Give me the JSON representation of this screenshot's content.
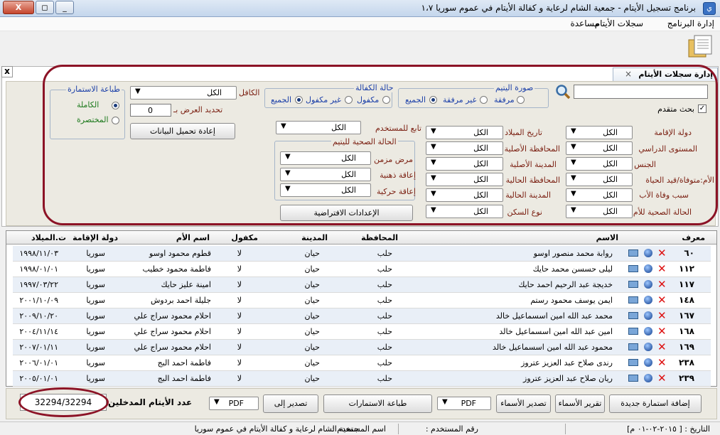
{
  "window": {
    "title": "برنامج تسجيل الأيتام - جمعية الشام لرعاية و كفالة الأيتام في عموم سوريا ١،٧",
    "minimize": "_",
    "restore": "◻",
    "close": "X"
  },
  "menu": [
    "إدارة البرنامج",
    "سجلات الأيتام",
    "مساعدة"
  ],
  "tab": {
    "label": "إدارة سجلات الأيتام",
    "close": "×"
  },
  "filters": {
    "advanced_search": "بحث متقدم",
    "photo_group": {
      "title": "صورة اليتيم",
      "options": [
        "مرفقة",
        "غير مرفقة",
        "الجميع"
      ],
      "selected": "الجميع"
    },
    "sponsorship_group": {
      "title": "حالة الكفالة",
      "options": [
        "مكفول",
        "غير مكفول",
        "الجميع"
      ],
      "selected": "الجميع"
    },
    "sponsor_label": "الكافل",
    "sponsor_value": "الكل",
    "limit_label": "تحديد العرض بـ",
    "limit_value": "0",
    "reload_button": "إعادة تحميل البيانات",
    "print_group": {
      "title": "طباعة الاستمارة",
      "options": [
        "الكاملة",
        "المختصرة"
      ],
      "selected": "الكاملة"
    },
    "user_label": "تابع للمستخدم",
    "user_value": "الكل",
    "health_group_title": "الحالة الصحية لليتيم",
    "health_fields": [
      {
        "label": "مرض مزمن",
        "value": "الكل"
      },
      {
        "label": "إعاقة ذهنية",
        "value": "الكل"
      },
      {
        "label": "إعاقة حركية",
        "value": "الكل"
      }
    ],
    "defaults_button": "الإعدادات الافتراضية",
    "col1": [
      {
        "label": "دولة الإقامة",
        "value": "الكل"
      },
      {
        "label": "المستوى الدراسي",
        "value": "الكل"
      },
      {
        "label": "الجنس",
        "value": "الكل"
      },
      {
        "label": "الأم:متوفاة/قيد الحياة",
        "value": "الكل"
      },
      {
        "label": "سبب وفاة الأب",
        "value": "الكل"
      },
      {
        "label": "الحالة الصحية للأم",
        "value": "الكل"
      }
    ],
    "col2": [
      {
        "label": "تاريخ الميلاد",
        "value": "الكل"
      },
      {
        "label": "المحافظة الأصلية",
        "value": "الكل"
      },
      {
        "label": "المدينة الأصلية",
        "value": "الكل"
      },
      {
        "label": "المحافظة الحالية",
        "value": "الكل"
      },
      {
        "label": "المدينة الحالية",
        "value": "الكل"
      },
      {
        "label": "نوع السكن",
        "value": "الكل"
      }
    ]
  },
  "table": {
    "headers": {
      "code": "معرف",
      "name": "الاسم",
      "province": "المحافظة",
      "city": "المدينة",
      "sponsored": "مكفول",
      "mother": "اسم الأم",
      "country": "دولة الإقامة",
      "dob": "ت.الميلاد"
    },
    "rows": [
      {
        "code": "٦٠",
        "name": "روابة محمد منصور اوسو",
        "province": "حلب",
        "city": "حيان",
        "sponsored": "لا",
        "mother": "قطوم محمود اوسو",
        "country": "سوريا",
        "dob": "١٩٩٨/١١/٠٣"
      },
      {
        "code": "١١٢",
        "name": "ليلى حسسن محمد حايك",
        "province": "حلب",
        "city": "حيان",
        "sponsored": "لا",
        "mother": "فاطمة محمود خطيب",
        "country": "سوريا",
        "dob": "١٩٩٨/٠١/٠١"
      },
      {
        "code": "١١٧",
        "name": "خديجة عبد الرحيم احمد حايك",
        "province": "حلب",
        "city": "حيان",
        "sponsored": "لا",
        "mother": "امينة عليز حايك",
        "country": "سوريا",
        "dob": "١٩٩٧/٠٣/٢٢"
      },
      {
        "code": "١٤٨",
        "name": "ايمن يوسف محمود رستم",
        "province": "حلب",
        "city": "حيان",
        "sponsored": "لا",
        "mother": "جليلة احمد بردوش",
        "country": "سوريا",
        "dob": "٢٠٠١/١٠/٠٩"
      },
      {
        "code": "١٦٧",
        "name": "محمد عبد الله امين اسسماعيل خالد",
        "province": "حلب",
        "city": "حيان",
        "sponsored": "لا",
        "mother": "احلام محمود سراج علي",
        "country": "سوريا",
        "dob": "٢٠٠٩/١٠/٢٠"
      },
      {
        "code": "١٦٨",
        "name": "امين عبد الله امين اسسماعيل خالد",
        "province": "حلب",
        "city": "حيان",
        "sponsored": "لا",
        "mother": "احلام محمود سراج علي",
        "country": "سوريا",
        "dob": "٢٠٠٤/١١/١٤"
      },
      {
        "code": "١٦٩",
        "name": "محمود عبد الله امين اسسماعيل خالد",
        "province": "حلب",
        "city": "حيان",
        "sponsored": "لا",
        "mother": "احلام محمود سراج علي",
        "country": "سوريا",
        "dob": "٢٠٠٧/٠١/١١"
      },
      {
        "code": "٢٣٨",
        "name": "رندى صلاح عبد العزيز عتروز",
        "province": "حلب",
        "city": "حيان",
        "sponsored": "لا",
        "mother": "فاطمة احمد البج",
        "country": "سوريا",
        "dob": "٢٠٠٦/٠١/٠١"
      },
      {
        "code": "٢٣٩",
        "name": "ريان صلاح عبد العزيز عتروز",
        "province": "حلب",
        "city": "حيان",
        "sponsored": "لا",
        "mother": "فاطمة احمد البج",
        "country": "سوريا",
        "dob": "٢٠٠٥/٠١/٠١"
      }
    ]
  },
  "bottom": {
    "add_button": "إضافة استمارة جديدة",
    "names_report_button": "تقرير الأسماء",
    "export_names_button": "تصدير الأسماء",
    "format1": "PDF",
    "print_forms_button": "طباعة الاستمارات",
    "export_to_button": "تصدير إلى",
    "format2": "PDF",
    "count_label": "عدد الأيتام المدخلين",
    "count_value": "32294/32294"
  },
  "status": {
    "date": "التاريخ : [ ٢٠١٥-٠٢-٠١ م]",
    "user": "رقم المستخدم :",
    "username": "اسم المستخدم :",
    "org": "جمعية الشام لرعاية و كفالة الأيتام في عموم سوريا"
  },
  "colors": {
    "accent_border": "#8c1326",
    "label_brown": "#7a1e10",
    "label_green": "#1e7a1e",
    "label_blue": "#1b3fa8"
  }
}
